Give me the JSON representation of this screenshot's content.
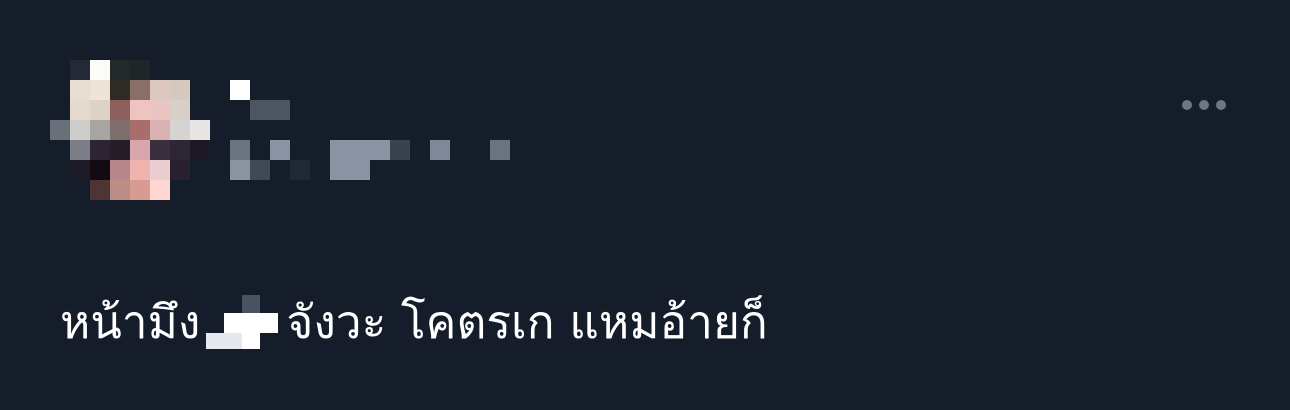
{
  "post": {
    "author": {
      "display_name": "",
      "handle": "",
      "avatar": "pixelated-avatar",
      "name_censored": true
    },
    "menu": {
      "icon": "more-horizontal-icon"
    },
    "text_before": "หน้ามึง",
    "text_censored": true,
    "text_after": "จังวะ โคตรเก แหมอ้ายก็"
  },
  "colors": {
    "background": "#151d2a",
    "text": "#ffffff",
    "muted": "#6e7787"
  }
}
